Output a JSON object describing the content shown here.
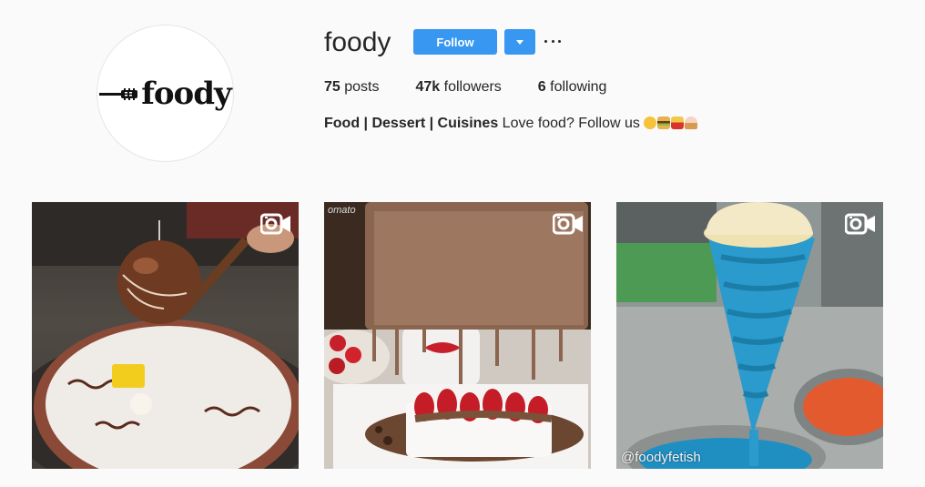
{
  "profile": {
    "logo_text": "foody",
    "username": "foody",
    "follow_label": "Follow",
    "stats": {
      "posts_count": "75",
      "posts_label": "posts",
      "followers_count": "47k",
      "followers_label": "followers",
      "following_count": "6",
      "following_label": "following"
    },
    "bio": {
      "bold": "Food | Dessert | Cuisines",
      "text": "Love food? Follow us"
    }
  },
  "posts": [
    {
      "type": "video",
      "icon": "video-camera-icon"
    },
    {
      "type": "video",
      "icon": "video-camera-icon",
      "sign_text": "omato"
    },
    {
      "type": "video",
      "icon": "video-camera-icon",
      "watermark": "@foodyfetish"
    }
  ],
  "colors": {
    "accent": "#3897f0",
    "background": "#fafafa",
    "text": "#262626"
  }
}
